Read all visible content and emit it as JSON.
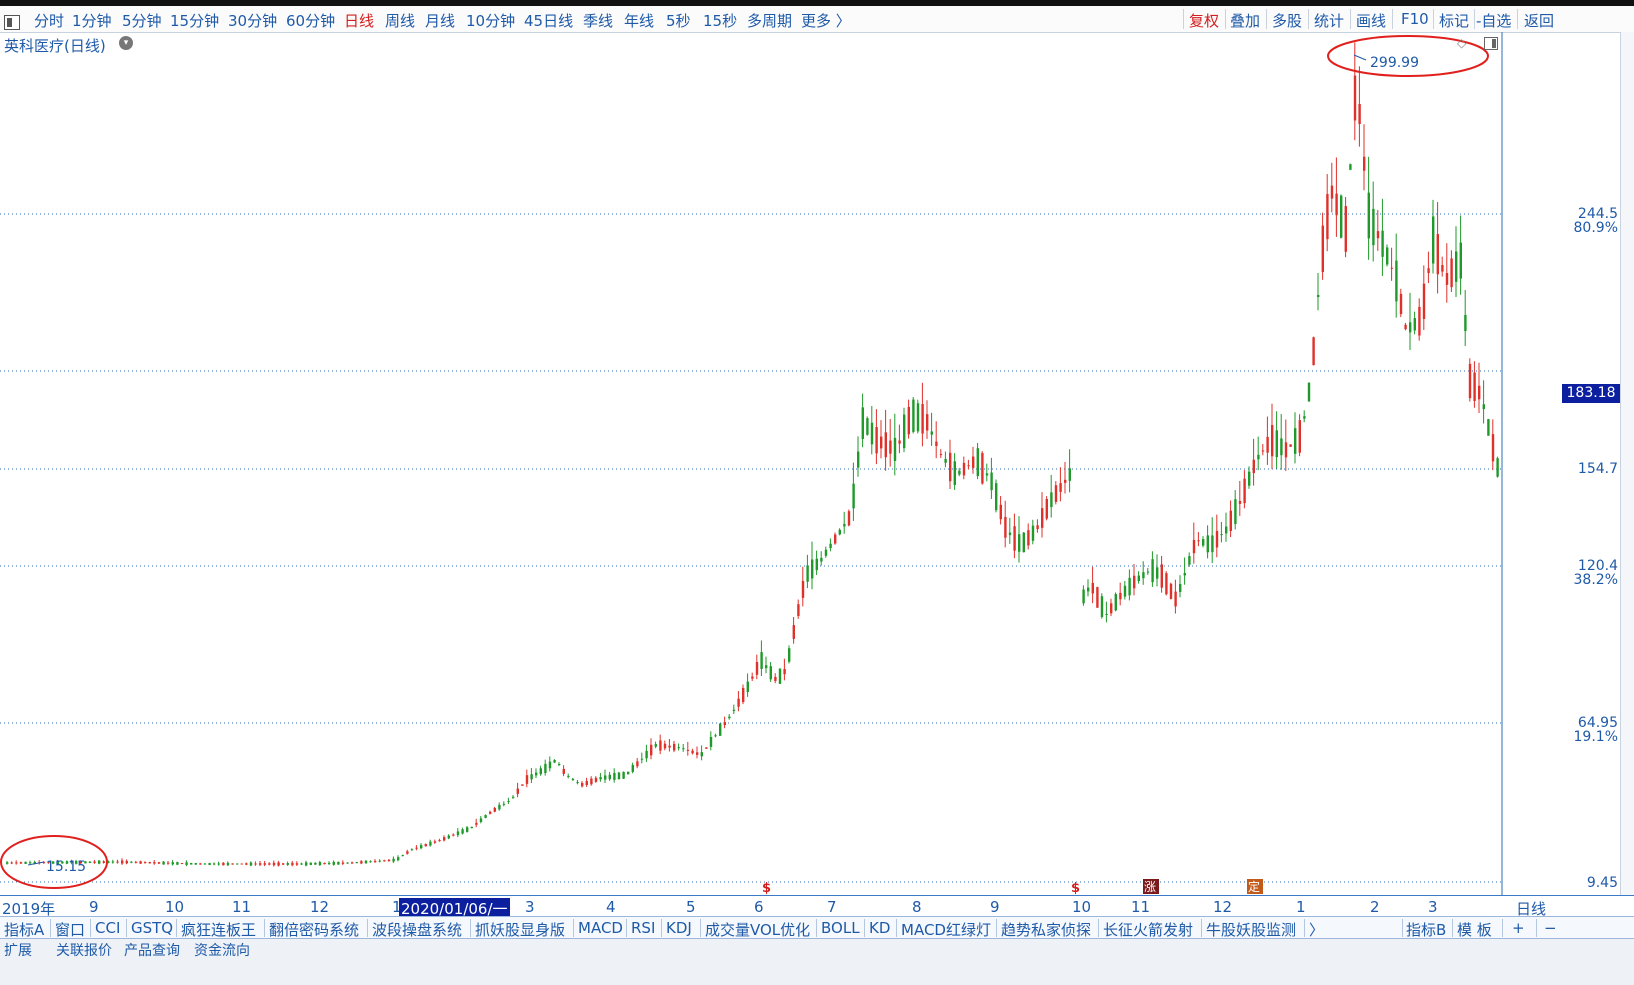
{
  "toolbar": {
    "periods": [
      "分时",
      "1分钟",
      "5分钟",
      "15分钟",
      "30分钟",
      "60分钟",
      "日线",
      "周线",
      "月线",
      "10分钟",
      "45日线",
      "季线",
      "年线",
      "5秒",
      "15秒",
      "多周期",
      "更多 〉"
    ],
    "active_period": "日线",
    "right_items": [
      "复权",
      "叠加",
      "多股",
      "统计",
      "画线",
      "F10",
      "标记",
      "-自选",
      "返回"
    ]
  },
  "stock_title": "英科医疗(日线)",
  "y_axis": {
    "gridlines": [
      {
        "price": "244.5",
        "pct": "80.9%"
      },
      {
        "price": "183.18",
        "pct": ""
      },
      {
        "price": "154.7",
        "pct": ""
      },
      {
        "price": "120.4",
        "pct": "38.2%"
      },
      {
        "price": "64.95",
        "pct": "19.1%"
      },
      {
        "price": "9.45",
        "pct": ""
      }
    ],
    "current_price_tag": "183.18"
  },
  "annotations": {
    "high_label": "299.99",
    "low_label": "15.15"
  },
  "x_axis": {
    "labels": [
      "2019年",
      "9",
      "10",
      "11",
      "12",
      "1",
      "2020/01/06/一",
      "3",
      "4",
      "5",
      "6",
      "7",
      "8",
      "9",
      "10",
      "11",
      "12",
      "1",
      "2",
      "3",
      "日线"
    ]
  },
  "markers": [
    "$",
    "$",
    "涨",
    "定"
  ],
  "indicators": [
    "指标A",
    "窗口",
    "CCI",
    "GSTQ",
    "疯狂连板王",
    "翻倍密码系统",
    "波段操盘系统",
    "抓妖股显身版",
    "MACD",
    "RSI",
    "KDJ",
    "成交量VOL优化",
    "BOLL",
    "KD",
    "MACD红绿灯",
    "趋势私家侦探",
    "长征火箭发射",
    "牛股妖股监测",
    "〉",
    "指标B",
    "模 板",
    "+",
    "−"
  ],
  "bottom_row": [
    "扩展",
    "关联报价",
    "产品查询",
    "资金流向"
  ],
  "colors": {
    "up": "#e0302a",
    "down": "#1f9a2a",
    "grid": "#2c6fb3",
    "accent": "#0b1f9f",
    "circle": "#e0201c"
  },
  "chart_data": {
    "type": "candlestick",
    "title": "英科医疗(日线)",
    "high": 299.99,
    "low": 15.15,
    "last": 183.18,
    "ylim": [
      9.45,
      300
    ],
    "periods": [
      "2019-08",
      "2019-09",
      "2019-10",
      "2019-11",
      "2019-12",
      "2020-01",
      "2020-02",
      "2020-03",
      "2020-04",
      "2020-05",
      "2020-06",
      "2020-07",
      "2020-08",
      "2020-09",
      "2020-10",
      "2020-11",
      "2020-12",
      "2021-01",
      "2021-02",
      "2021-03"
    ]
  }
}
